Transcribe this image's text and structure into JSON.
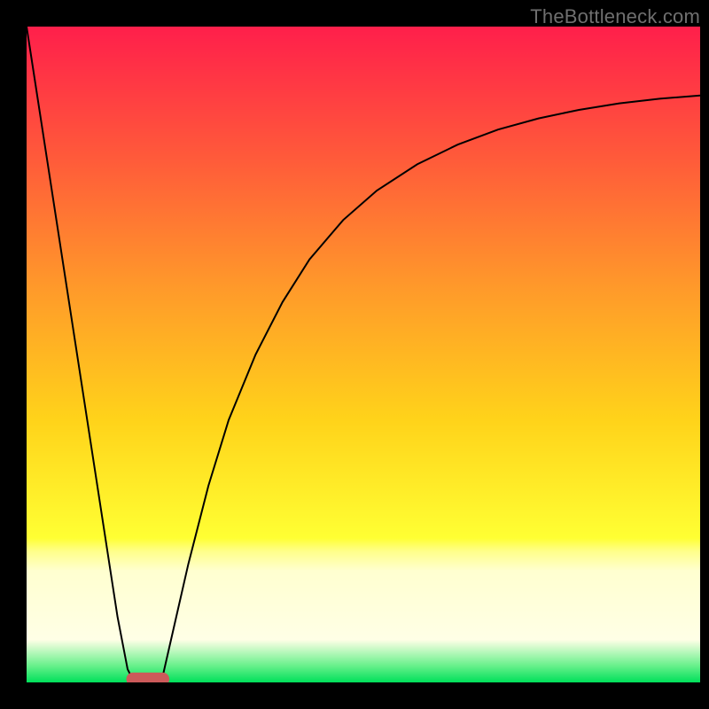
{
  "watermark": "TheBottleneck.com",
  "chart_data": {
    "type": "line",
    "title": "",
    "xlabel": "",
    "ylabel": "",
    "xlim": [
      0,
      100
    ],
    "ylim": [
      0,
      100
    ],
    "grid": false,
    "legend": false,
    "gradient_stops": [
      {
        "offset": 0.0,
        "color": "#ff1f4b"
      },
      {
        "offset": 0.2,
        "color": "#ff5a3a"
      },
      {
        "offset": 0.4,
        "color": "#ff9a2a"
      },
      {
        "offset": 0.6,
        "color": "#ffd31a"
      },
      {
        "offset": 0.78,
        "color": "#ffff33"
      },
      {
        "offset": 0.8,
        "color": "#ffff8a"
      },
      {
        "offset": 0.83,
        "color": "#ffffd0"
      },
      {
        "offset": 0.935,
        "color": "#ffffe6"
      },
      {
        "offset": 0.975,
        "color": "#66f08a"
      },
      {
        "offset": 1.0,
        "color": "#00e05a"
      }
    ],
    "series": [
      {
        "name": "left-leg",
        "x": [
          0.0,
          3.0,
          6.0,
          9.0,
          12.0,
          13.5,
          15.0,
          16.0
        ],
        "y": [
          100.0,
          80.0,
          60.0,
          40.0,
          20.0,
          10.0,
          2.0,
          0.0
        ]
      },
      {
        "name": "right-curve",
        "x": [
          20.0,
          22.0,
          24.0,
          27.0,
          30.0,
          34.0,
          38.0,
          42.0,
          47.0,
          52.0,
          58.0,
          64.0,
          70.0,
          76.0,
          82.0,
          88.0,
          94.0,
          100.0
        ],
        "y": [
          0.0,
          9.0,
          18.0,
          30.0,
          40.0,
          50.0,
          58.0,
          64.5,
          70.5,
          75.0,
          79.0,
          82.0,
          84.3,
          86.0,
          87.3,
          88.3,
          89.0,
          89.5
        ]
      }
    ],
    "marker": {
      "name": "valley-marker",
      "x": 18.0,
      "y": 0.5,
      "rx": 3.2,
      "ry": 1.0,
      "color": "#cc5a5a"
    }
  }
}
